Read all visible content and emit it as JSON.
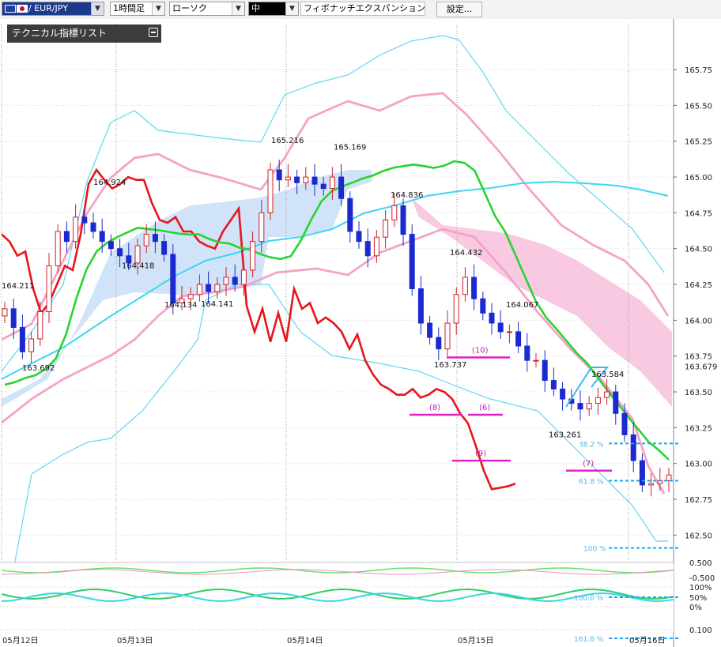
{
  "toolbar": {
    "symbol": "/ EUR/JPY",
    "period": "1時間足",
    "chart_type": "ローソク",
    "line_width": "中",
    "drawing_tool": "フィボナッチエクスパンション",
    "settings": "設定..."
  },
  "indicator_list": {
    "title": "テクニカル指標リスト"
  },
  "chart_data": {
    "type": "candlestick",
    "symbol": "EUR/JPY",
    "timeframe": "1時間足",
    "y_ticks": [
      "165.75",
      "165.50",
      "165.25",
      "165.00",
      "164.75",
      "164.50",
      "164.25",
      "164.00",
      "163.75",
      "163.50",
      "163.25",
      "163.00",
      "162.75",
      "162.50"
    ],
    "x_ticks": [
      "05月12日",
      "05月13日",
      "05月14日",
      "05月15日",
      "05月16日"
    ],
    "ylim": [
      162.32,
      165.96
    ],
    "current_price": "163.679",
    "price_labels": [
      {
        "text": "164.211",
        "value": 164.211
      },
      {
        "text": "163.692",
        "value": 163.692
      },
      {
        "text": "164.924",
        "value": 164.924
      },
      {
        "text": "164.418",
        "value": 164.418
      },
      {
        "text": "164.134",
        "value": 164.134
      },
      {
        "text": "164.141",
        "value": 164.141
      },
      {
        "text": "165.216",
        "value": 165.216
      },
      {
        "text": "165.169",
        "value": 165.169
      },
      {
        "text": "164.836",
        "value": 164.836
      },
      {
        "text": "164.432",
        "value": 164.432
      },
      {
        "text": "164.067",
        "value": 164.067
      },
      {
        "text": "163.737",
        "value": 163.737
      },
      {
        "text": "163.584",
        "value": 163.584
      },
      {
        "text": "163.261",
        "value": 163.261
      }
    ],
    "count_markers": [
      {
        "text": "(10)",
        "value": 163.74
      },
      {
        "text": "(8)",
        "value": 163.34
      },
      {
        "text": "(6)",
        "value": 163.34
      },
      {
        "text": "(9)",
        "value": 163.02
      },
      {
        "text": "(7)",
        "value": 162.95
      }
    ],
    "fibonacci_levels": [
      {
        "text": "38.2 %",
        "value": 163.14
      },
      {
        "text": "61.8 %",
        "value": 162.88
      },
      {
        "text": "100 %",
        "value": 162.41
      },
      {
        "text": "161.8 %",
        "value": null
      }
    ],
    "oscillator_ticks": [
      "0.500",
      "-0.500",
      "100%",
      "50%",
      "0%",
      "0.100"
    ],
    "oscillator_labels": [
      "100.0 %"
    ],
    "series": [
      {
        "name": "close",
        "values": [
          164.08,
          163.95,
          163.78,
          163.87,
          164.06,
          164.38,
          164.62,
          164.55,
          164.72,
          164.68,
          164.62,
          164.55,
          164.5,
          164.45,
          164.4,
          164.52,
          164.6,
          164.55,
          164.46,
          164.12,
          164.15,
          164.18,
          164.25,
          164.2,
          164.25,
          164.3,
          164.25,
          164.35,
          164.55,
          164.75,
          165.05,
          164.98,
          165.0,
          164.96,
          165.0,
          164.95,
          164.92,
          165.0,
          164.85,
          164.62,
          164.55,
          164.45,
          164.58,
          164.7,
          164.8,
          164.6,
          164.22,
          163.98,
          163.88,
          163.8,
          163.98,
          164.18,
          164.3,
          164.15,
          164.05,
          163.98,
          163.92,
          163.92,
          163.82,
          163.72,
          163.72,
          163.58,
          163.52,
          163.45,
          163.42,
          163.38,
          163.42,
          163.46,
          163.5,
          163.35,
          163.2,
          163.02,
          162.85,
          162.86,
          162.88,
          162.92
        ]
      },
      {
        "name": "chikou",
        "values": [
          164.6,
          164.55,
          164.45,
          164.48,
          164.22,
          164.05,
          164.12,
          164.25,
          164.38,
          164.35,
          164.6,
          164.95,
          165.05,
          164.98,
          164.92,
          164.95,
          165.0,
          164.98,
          164.98,
          164.82,
          164.7,
          164.68,
          164.72,
          164.62,
          164.62,
          164.55,
          164.52,
          164.5,
          164.62,
          164.7,
          164.78,
          164.1,
          163.92,
          164.08,
          163.85,
          164.05,
          163.85,
          164.22,
          164.08,
          164.12,
          163.98,
          164.02,
          163.98,
          163.92,
          163.8,
          163.9,
          163.72,
          163.62,
          163.55,
          163.52,
          163.48,
          163.48,
          163.52,
          163.46,
          163.48,
          163.52,
          163.5,
          163.45,
          163.35,
          163.28,
          163.12,
          162.95,
          162.82,
          162.83,
          162.84,
          162.86
        ]
      },
      {
        "name": "kijun",
        "values": [
          163.55,
          163.58,
          163.62,
          163.65,
          163.7,
          163.78,
          163.95,
          164.2,
          164.4,
          164.52,
          164.57,
          164.6,
          164.62,
          164.64,
          164.62,
          164.6,
          164.58,
          164.56,
          164.55,
          164.55,
          164.52,
          164.5,
          164.5,
          164.48,
          164.48,
          164.46,
          164.45,
          164.45,
          164.48,
          164.6,
          164.75,
          164.88,
          164.95,
          164.98,
          165.0,
          165.02,
          165.03,
          165.05,
          165.06,
          165.06,
          165.06,
          165.04,
          165.02,
          165.03,
          165.06,
          165.05,
          165.0,
          164.85,
          164.7,
          164.6,
          164.45,
          164.3,
          164.15,
          164.05,
          163.98,
          163.9,
          163.82,
          163.75,
          163.65,
          163.55,
          163.45,
          163.35,
          163.25,
          163.15,
          163.08,
          163.0
        ]
      },
      {
        "name": "bb_upper_1",
        "values": [
          163.9,
          163.95,
          164.05,
          164.2,
          164.45,
          164.7,
          164.8,
          164.85,
          164.88,
          164.9,
          164.92,
          164.93,
          164.93,
          164.93,
          164.92,
          164.88,
          164.82,
          164.8,
          164.78,
          164.78,
          164.77,
          164.76,
          164.76,
          164.75,
          164.75,
          164.76,
          164.77,
          164.8,
          164.9,
          165.0,
          165.15,
          165.25,
          165.3,
          165.33,
          165.36,
          165.38,
          165.38,
          165.35,
          165.3,
          165.23,
          165.15,
          165.1,
          165.1,
          165.12,
          165.18,
          165.25,
          165.35,
          165.4,
          165.38,
          165.35,
          165.25,
          165.15,
          165.05,
          164.95,
          164.85,
          164.75,
          164.65,
          164.55,
          164.45,
          164.35,
          164.25,
          164.15,
          164.05,
          163.95,
          163.85
        ]
      }
    ]
  }
}
